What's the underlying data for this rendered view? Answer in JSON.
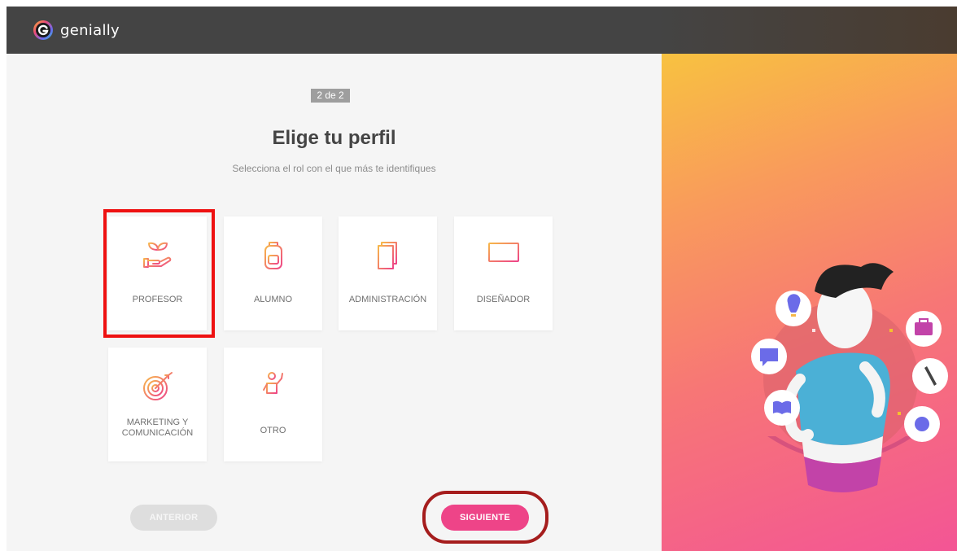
{
  "header": {
    "logo_text": "genially"
  },
  "step": {
    "label": "2 de 2"
  },
  "page": {
    "title": "Elige tu perfil",
    "subtitle": "Selecciona el rol con el que más te identifiques"
  },
  "profiles": [
    {
      "label": "PROFESOR",
      "icon": "plant-hand-icon",
      "selected": true
    },
    {
      "label": "ALUMNO",
      "icon": "backpack-icon"
    },
    {
      "label": "ADMINISTRACIÓN",
      "icon": "documents-icon"
    },
    {
      "label": "DISEÑADOR",
      "icon": "monitor-icon"
    },
    {
      "label": "MARKETING Y COMUNICACIÓN",
      "icon": "target-icon"
    },
    {
      "label": "OTRO",
      "icon": "person-waving-icon"
    }
  ],
  "buttons": {
    "previous": "ANTERIOR",
    "next": "SIGUIENTE"
  },
  "colors": {
    "accent": "#ee4488",
    "icon_gradient": [
      "#f7b84a",
      "#ee4488"
    ],
    "topbar": "#444444",
    "selection_highlight": "#ee1111"
  }
}
